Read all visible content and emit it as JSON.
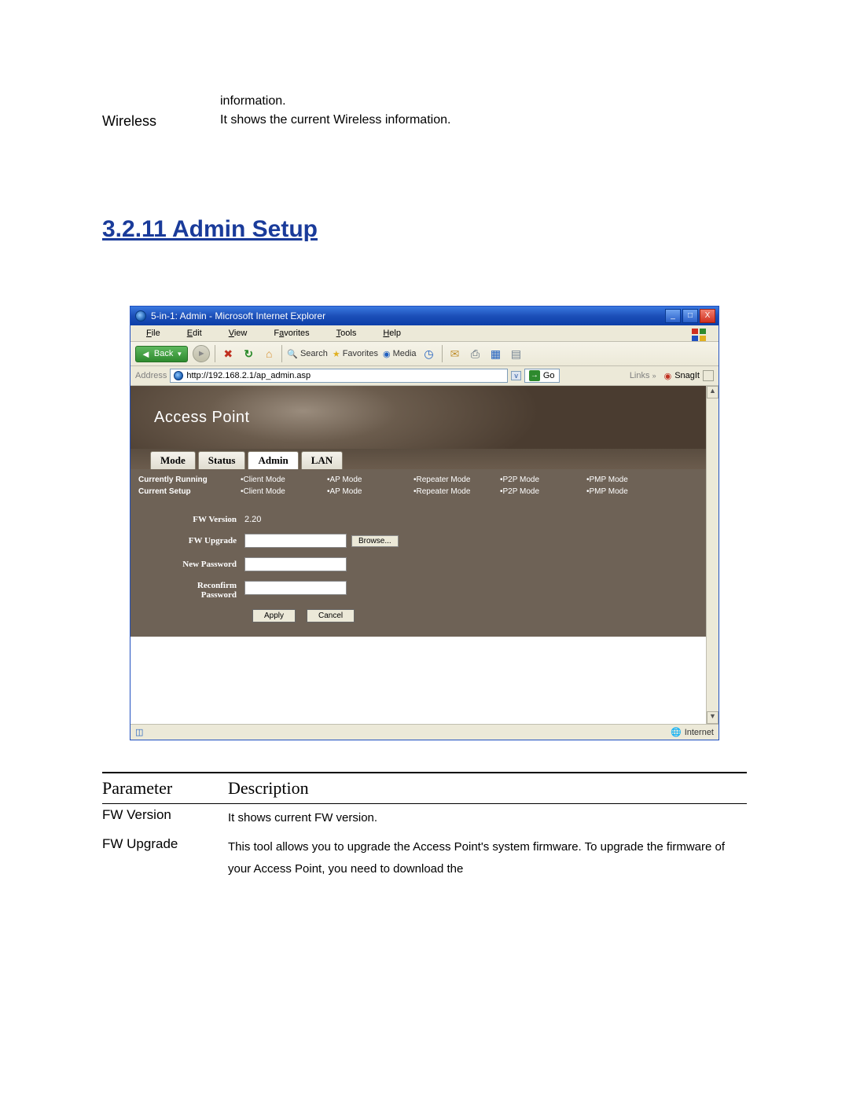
{
  "intro": {
    "row0_right": "information.",
    "row1_left": "Wireless",
    "row1_right": "It shows the current Wireless information."
  },
  "section_heading": "3.2.11     Admin Setup",
  "browser": {
    "title": "5-in-1: Admin - Microsoft Internet Explorer",
    "menu": {
      "file": "File",
      "edit": "Edit",
      "view": "View",
      "favorites": "Favorites",
      "tools": "Tools",
      "help": "Help"
    },
    "toolbar": {
      "back": "Back",
      "search": "Search",
      "favorites": "Favorites",
      "media": "Media"
    },
    "address_label": "Address",
    "url": "http://192.168.2.1/ap_admin.asp",
    "go": "Go",
    "links": "Links",
    "snagit": "SnagIt",
    "status_zone": "Internet"
  },
  "page": {
    "banner": "Access Point",
    "tabs": {
      "mode": "Mode",
      "status": "Status",
      "admin": "Admin",
      "lan": "LAN"
    },
    "modes": {
      "running_label": "Currently Running",
      "setup_label": "Current Setup",
      "cols": [
        "•Client Mode",
        "•AP Mode",
        "•Repeater Mode",
        "•P2P Mode",
        "•PMP Mode"
      ]
    },
    "form": {
      "fw_version_label": "FW Version",
      "fw_version_value": "2.20",
      "fw_upgrade_label": "FW Upgrade",
      "browse": "Browse...",
      "new_pw_label": "New Password",
      "reconfirm_label1": "Reconfirm",
      "reconfirm_label2": "Password",
      "apply": "Apply",
      "cancel": "Cancel"
    }
  },
  "param_table": {
    "h_param": "Parameter",
    "h_desc": "Description",
    "rows": [
      {
        "p": "FW Version",
        "d": "It shows current FW version."
      },
      {
        "p": "FW Upgrade",
        "d": "This tool allows you to upgrade the Access Point's system firmware. To upgrade the firmware of your Access Point, you need to download the"
      }
    ]
  }
}
